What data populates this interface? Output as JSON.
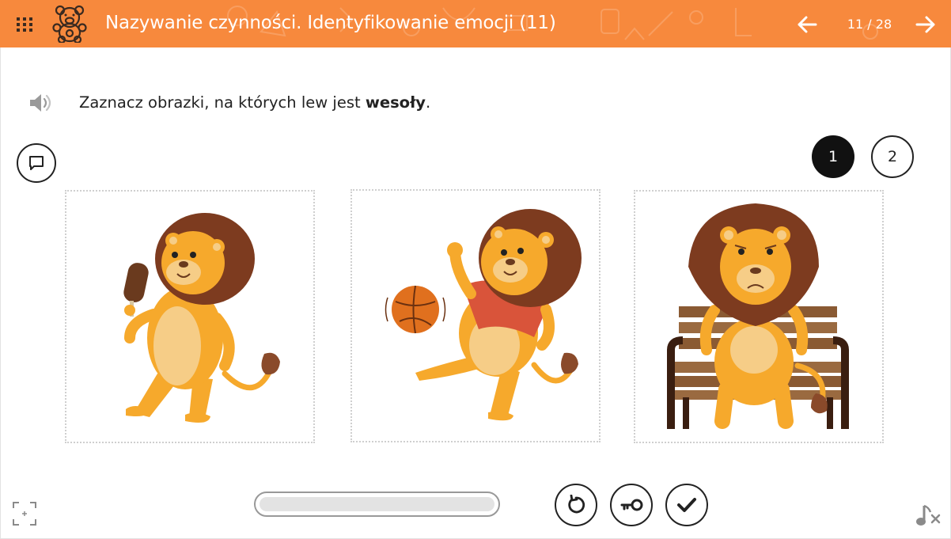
{
  "header": {
    "title": "Nazywanie czynności. Identyfikowanie emocji (11)",
    "page_counter": "11 / 28",
    "background_color": "#f7893d",
    "menu_icon": "grid-menu-icon",
    "logo_icon": "teddy-bear-icon",
    "prev_icon": "arrow-left-icon",
    "next_icon": "arrow-right-icon"
  },
  "instruction": {
    "text_before": "Zaznacz obrazki, na których lew jest ",
    "text_bold": "wesoły",
    "text_after": ".",
    "speaker_icon": "speaker-icon"
  },
  "comment_icon": "comment-icon",
  "pages": [
    {
      "label": "1",
      "active": true
    },
    {
      "label": "2",
      "active": false
    }
  ],
  "cards": [
    {
      "picture": "lion-with-ice-cream",
      "emotion": "happy"
    },
    {
      "picture": "lion-kicking-ball",
      "emotion": "happy"
    },
    {
      "picture": "lion-sitting-on-bench",
      "emotion": "sad"
    }
  ],
  "progress": {
    "fraction": 0.0
  },
  "actions": [
    {
      "name": "reset",
      "icon": "reset-icon"
    },
    {
      "name": "show-answer",
      "icon": "key-icon"
    },
    {
      "name": "check",
      "icon": "checkmark-icon"
    }
  ],
  "footer": {
    "fullscreen_icon": "fullscreen-icon",
    "music_icon": "music-off-icon"
  }
}
